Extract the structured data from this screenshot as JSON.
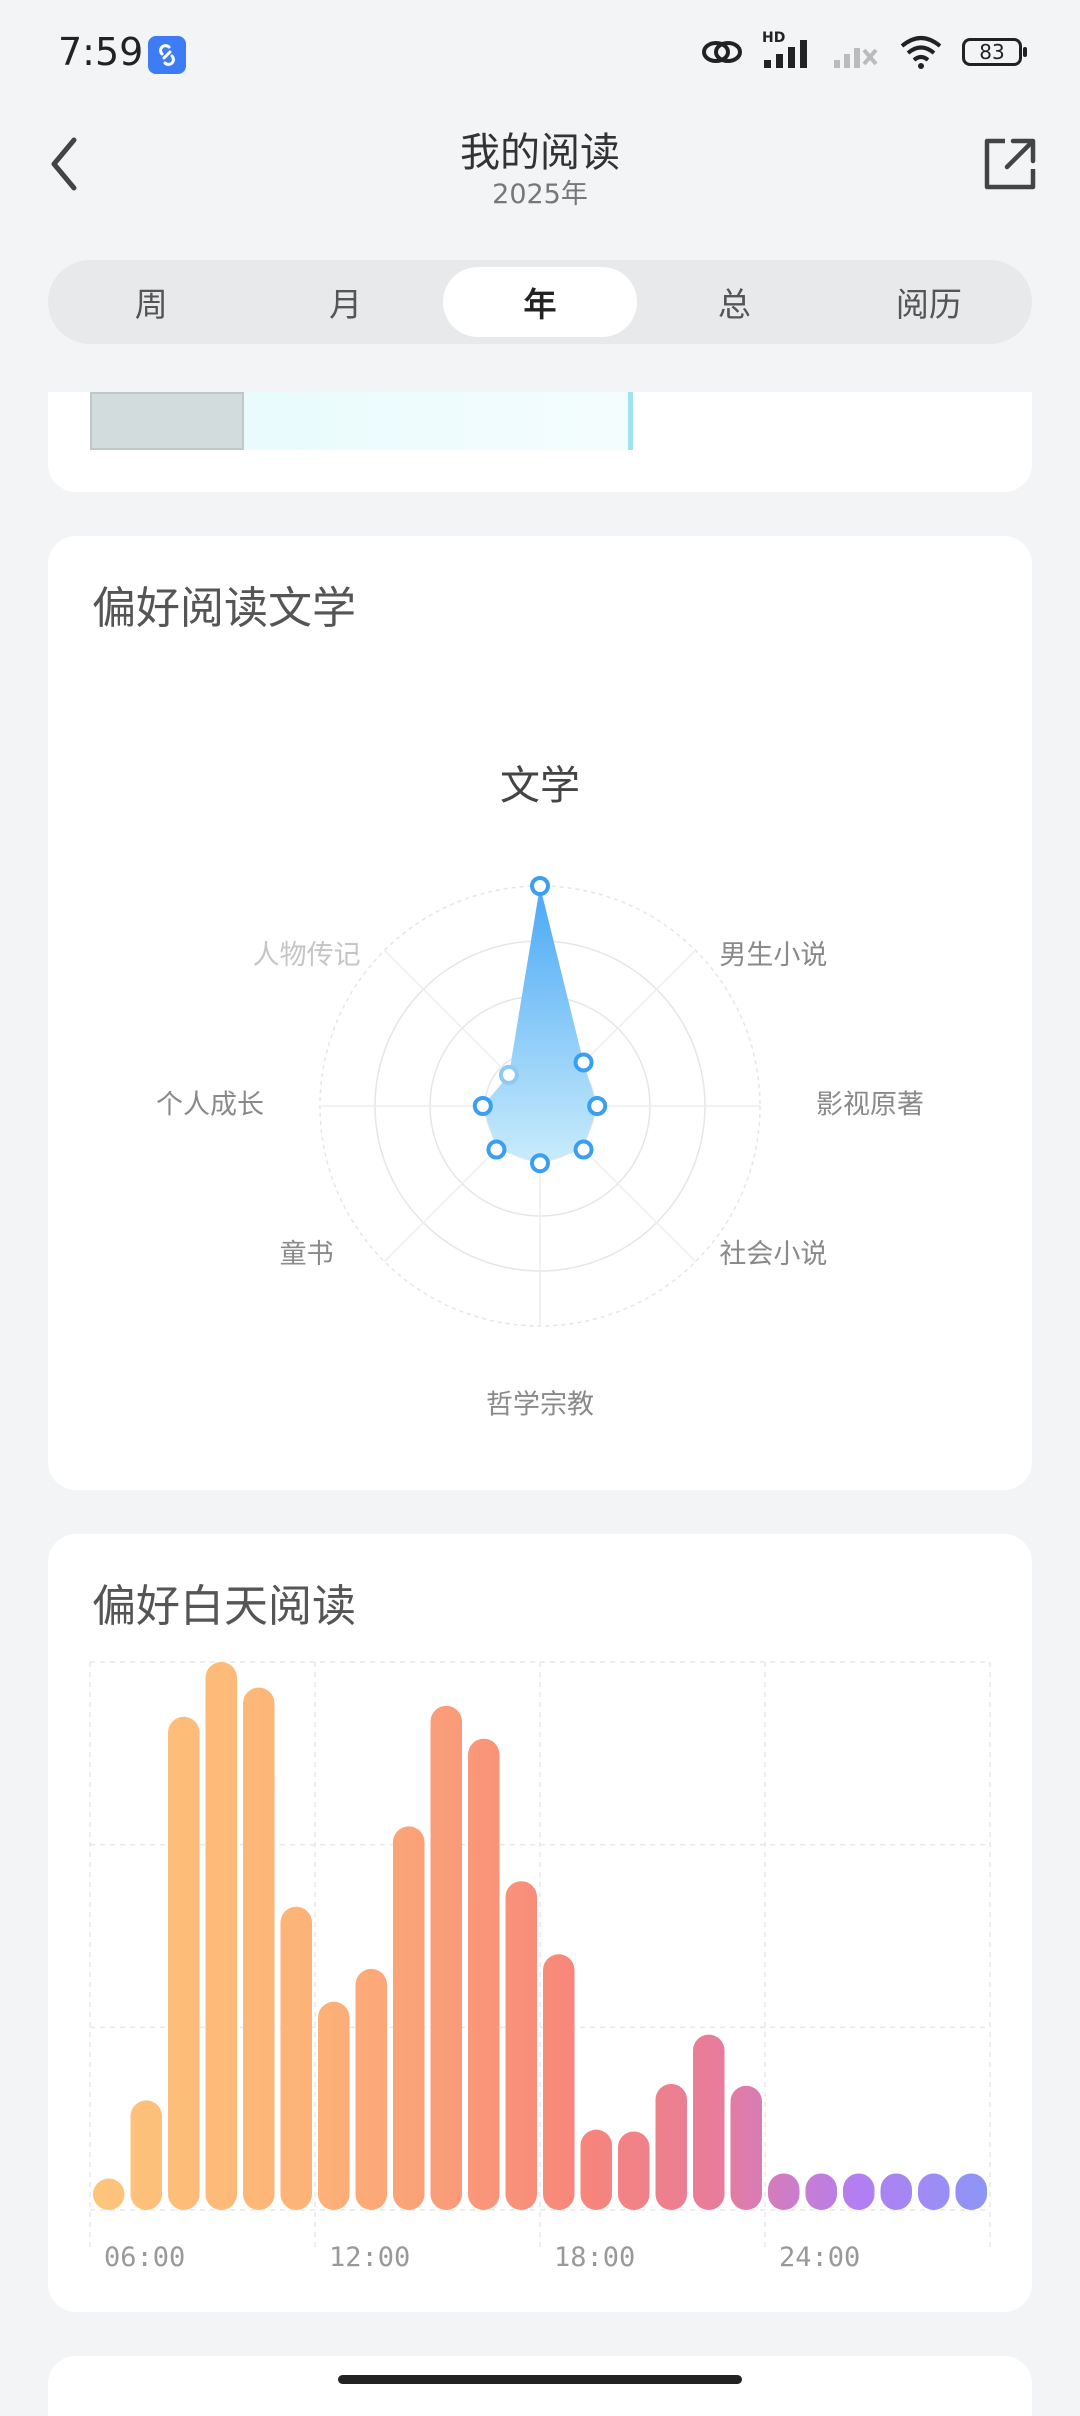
{
  "status_bar": {
    "time": "7:59",
    "battery": "83",
    "hd_label": "HD"
  },
  "header": {
    "title": "我的阅读",
    "subtitle": "2025年"
  },
  "tabs": [
    {
      "label": "周",
      "active": false
    },
    {
      "label": "月",
      "active": false
    },
    {
      "label": "年",
      "active": true
    },
    {
      "label": "总",
      "active": false
    },
    {
      "label": "阅历",
      "active": false
    }
  ],
  "literature_card": {
    "title": "偏好阅读文学",
    "center_label": "文学"
  },
  "reading_card": {
    "title": "偏好白天阅读"
  },
  "colors": {
    "accent_blue": "#3a9ff0",
    "radar_fill_top": "#49a8f5",
    "radar_fill_bottom": "#c9ecfb",
    "bar_orange": "#fdbd77",
    "bar_red": "#f78378",
    "bar_purple": "#b37df2"
  },
  "chart_data": [
    {
      "type": "radar",
      "title": "文学",
      "categories": [
        "男生小说",
        "影视原著",
        "社会小说",
        "哲学宗教",
        "童书",
        "个人成长",
        "人物传记"
      ],
      "category_order_note": "",
      "top_axis_category": "文学",
      "values": {
        "文学": 1.0,
        "男生小说": 0.28,
        "影视原著": 0.26,
        "社会小说": 0.28,
        "哲学宗教": 0.26,
        "童书": 0.28,
        "个人成长": 0.26,
        "人物传记": 0.2
      },
      "max": 1.0,
      "rings": 4,
      "grid": true
    },
    {
      "type": "bar",
      "title": "偏好白天阅读",
      "x_tick_labels": [
        "06:00",
        "12:00",
        "18:00",
        "24:00"
      ],
      "values": [
        1.6,
        6.0,
        27.0,
        30.2,
        28.6,
        16.6,
        11.4,
        13.2,
        21.0,
        27.6,
        25.8,
        18.0,
        14.0,
        4.4,
        4.3,
        6.9,
        9.6,
        6.8,
        2.0,
        2.0,
        2.0,
        2.0,
        2.0,
        2.0
      ],
      "ylim": [
        0,
        30
      ],
      "grid": true
    }
  ]
}
